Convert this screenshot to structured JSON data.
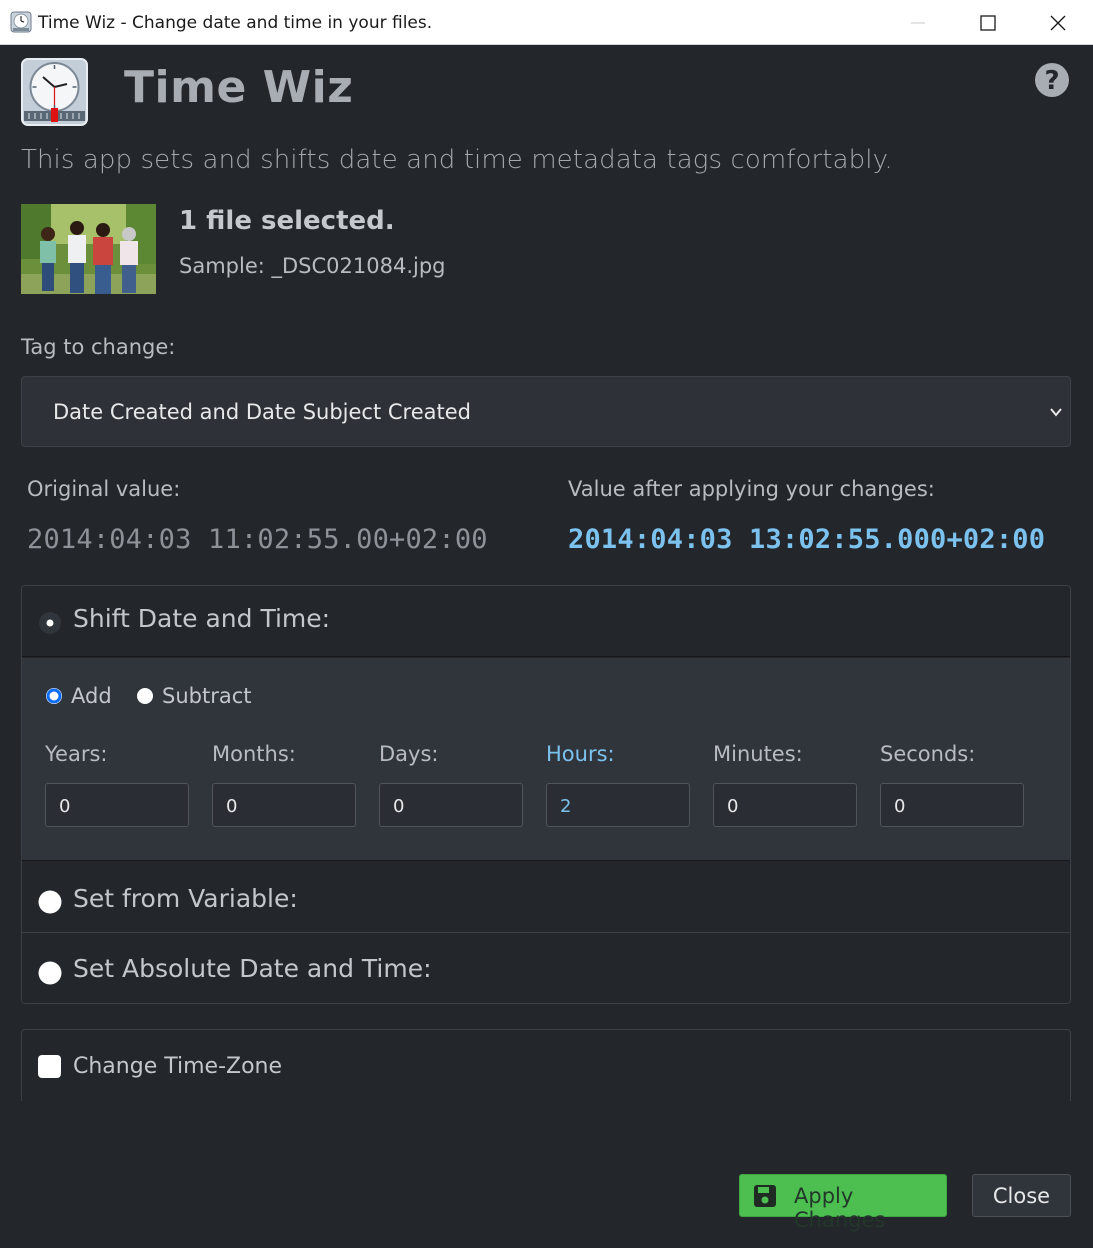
{
  "window": {
    "title": "Time Wiz - Change date and time in your files."
  },
  "header": {
    "app_name": "Time Wiz",
    "subtitle": "This app sets and shifts date and time metadata tags comfortably."
  },
  "files": {
    "count_text": "1 file selected.",
    "sample_text": "Sample: _DSC021084.jpg"
  },
  "tag": {
    "label": "Tag to change:",
    "selected": "Date Created and Date Subject Created"
  },
  "values": {
    "original_label": "Original value:",
    "original": "2014:04:03 11:02:55.00+02:00",
    "new_label": "Value after applying your changes:",
    "new": "2014:04:03 13:02:55.000+02:00"
  },
  "shift": {
    "title": "Shift Date and Time:",
    "add_label": "Add",
    "subtract_label": "Subtract",
    "mode": "Add",
    "fields": {
      "years": {
        "label": "Years:",
        "value": "0"
      },
      "months": {
        "label": "Months:",
        "value": "0"
      },
      "days": {
        "label": "Days:",
        "value": "0"
      },
      "hours": {
        "label": "Hours:",
        "value": "2"
      },
      "minutes": {
        "label": "Minutes:",
        "value": "0"
      },
      "seconds": {
        "label": "Seconds:",
        "value": "0"
      }
    }
  },
  "set_variable": {
    "title": "Set from Variable:"
  },
  "set_absolute": {
    "title": "Set Absolute Date and Time:"
  },
  "timezone": {
    "label": "Change Time-Zone",
    "checked": false
  },
  "buttons": {
    "apply": "Apply Changes",
    "close": "Close"
  },
  "colors": {
    "accent": "#7cc2ef",
    "apply_green": "#4dbf50",
    "background": "#23262b"
  }
}
